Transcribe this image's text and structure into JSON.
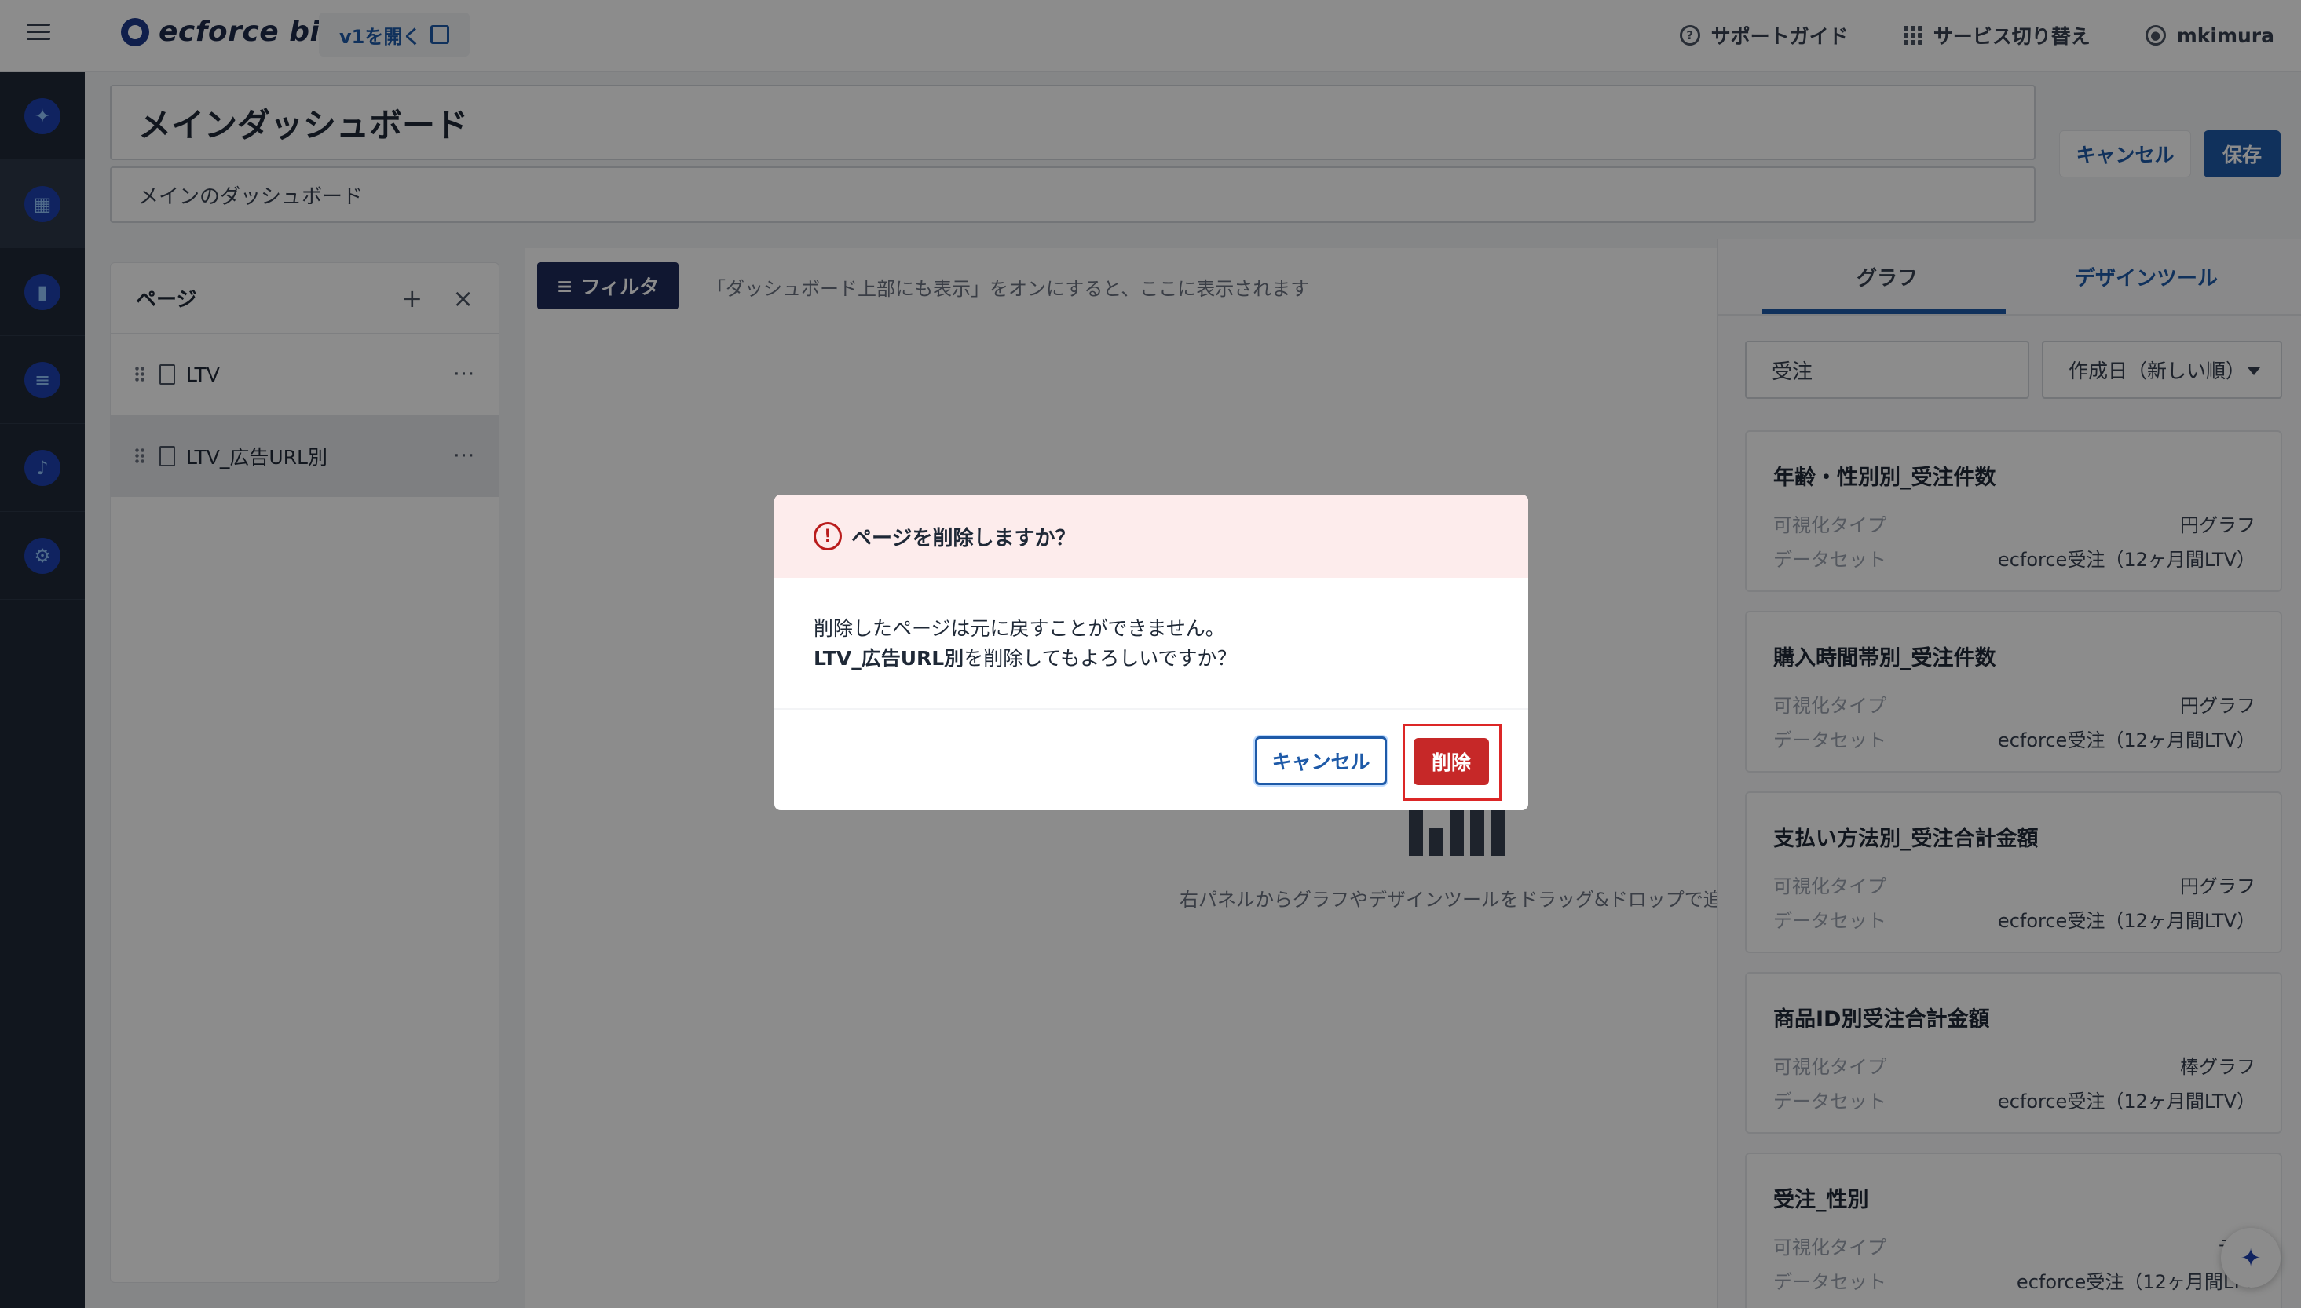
{
  "header": {
    "logo_text": "ecforce bi",
    "v1_link": "v1を開く",
    "support": "サポートガイド",
    "switch_service": "サービス切り替え",
    "user": "mkimura"
  },
  "dashboard": {
    "title": "メインダッシュボード",
    "description": "メインのダッシュボード",
    "cancel_label": "キャンセル",
    "save_label": "保存"
  },
  "pages": {
    "header": "ページ",
    "items": [
      {
        "label": "LTV",
        "selected": false
      },
      {
        "label": "LTV_広告URL別",
        "selected": true
      }
    ]
  },
  "canvas": {
    "filter_label": "フィルタ",
    "filter_hint": "「ダッシュボード上部にも表示」をオンにすると、ここに表示されます",
    "empty_hint": "右パネルからグラフやデザインツールをドラッグ&ドロップで追"
  },
  "right_panel": {
    "tabs": [
      "グラフ",
      "デザインツール"
    ],
    "active_tab": "グラフ",
    "search_value": "受注",
    "sort_value": "作成日（新しい順）",
    "type_key": "可視化タイプ",
    "dataset_key": "データセット",
    "cards": [
      {
        "title": "年齢・性別別_受注件数",
        "type": "円グラフ",
        "dataset": "ecforce受注（12ヶ月間LTV）"
      },
      {
        "title": "購入時間帯別_受注件数",
        "type": "円グラフ",
        "dataset": "ecforce受注（12ヶ月間LTV）"
      },
      {
        "title": "支払い方法別_受注合計金額",
        "type": "円グラフ",
        "dataset": "ecforce受注（12ヶ月間LTV）"
      },
      {
        "title": "商品ID別受注合計金額",
        "type": "棒グラフ",
        "dataset": "ecforce受注（12ヶ月間LTV）"
      },
      {
        "title": "受注_性別",
        "type": "テー",
        "dataset": "ecforce受注（12ヶ月間LTV"
      }
    ]
  },
  "dialog": {
    "title": "ページを削除しますか？",
    "line1": "削除したページは元に戻すことができません。",
    "page_name": "LTV_広告URL別",
    "line2_suffix": "を削除してもよろしいですか？",
    "cancel_label": "キャンセル",
    "delete_label": "削除"
  },
  "colors": {
    "primary": "#1e5aa8",
    "danger": "#c62828",
    "sidebar_bg": "#1f2937"
  }
}
